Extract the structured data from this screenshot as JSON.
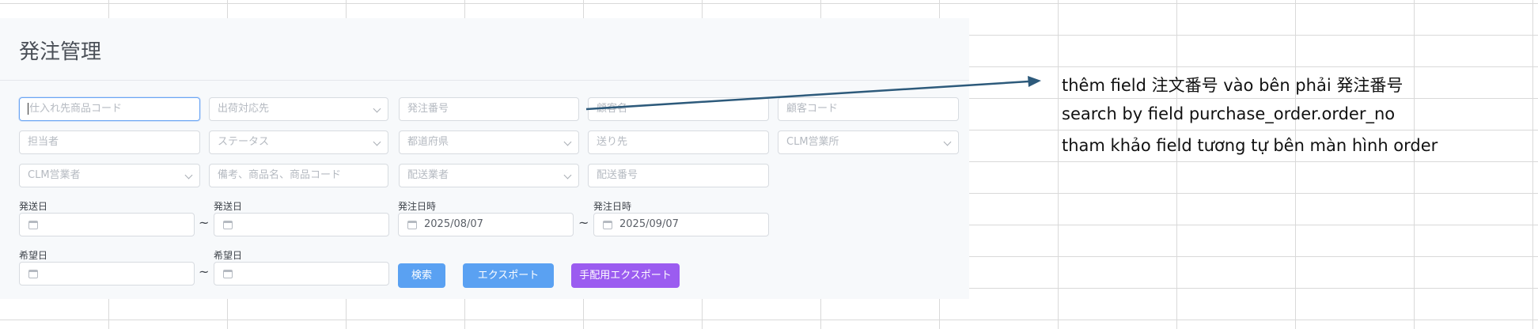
{
  "title": "発注管理",
  "row1": {
    "supplier_code_placeholder": "仕入れ先商品コード",
    "shipping_partner_placeholder": "出荷対応先",
    "order_no_placeholder": "発注番号",
    "customer_name_placeholder": "顧客名",
    "customer_code_placeholder": "顧客コード"
  },
  "row2": {
    "assignee_placeholder": "担当者",
    "status_placeholder": "ステータス",
    "prefecture_placeholder": "都道府県",
    "ship_to_placeholder": "送り先",
    "clm_office_placeholder": "CLM営業所"
  },
  "row3": {
    "clm_sales_placeholder": "CLM営業者",
    "remarks_placeholder": "備考、商品名、商品コード",
    "carrier_placeholder": "配送業者",
    "tracking_no_placeholder": "配送番号"
  },
  "dates": {
    "ship_date_label": "発送日",
    "ship_date_to_label": "発送日",
    "order_datetime_label": "発注日時",
    "order_datetime_to_label": "発注日時",
    "order_datetime_from": "2025/08/07",
    "order_datetime_to": "2025/09/07",
    "desired_date_label": "希望日",
    "desired_date_to_label": "希望日",
    "range_sep": "~"
  },
  "buttons": {
    "search": "検索",
    "export": "エクスポート",
    "arrangement_export": "手配用エクスポート"
  },
  "notes": [
    "thêm field 注文番号 vào bên phải 発注番号",
    "search by field purchase_order.order_no",
    "tham khảo field tương tự bên màn hình order"
  ],
  "colors": {
    "accent_blue": "#5aa1f2",
    "accent_purple": "#9b5cf0",
    "arrow": "#2d5a7b"
  },
  "icons": {
    "dropdown": "chevron-down-icon",
    "date": "calendar-icon"
  }
}
